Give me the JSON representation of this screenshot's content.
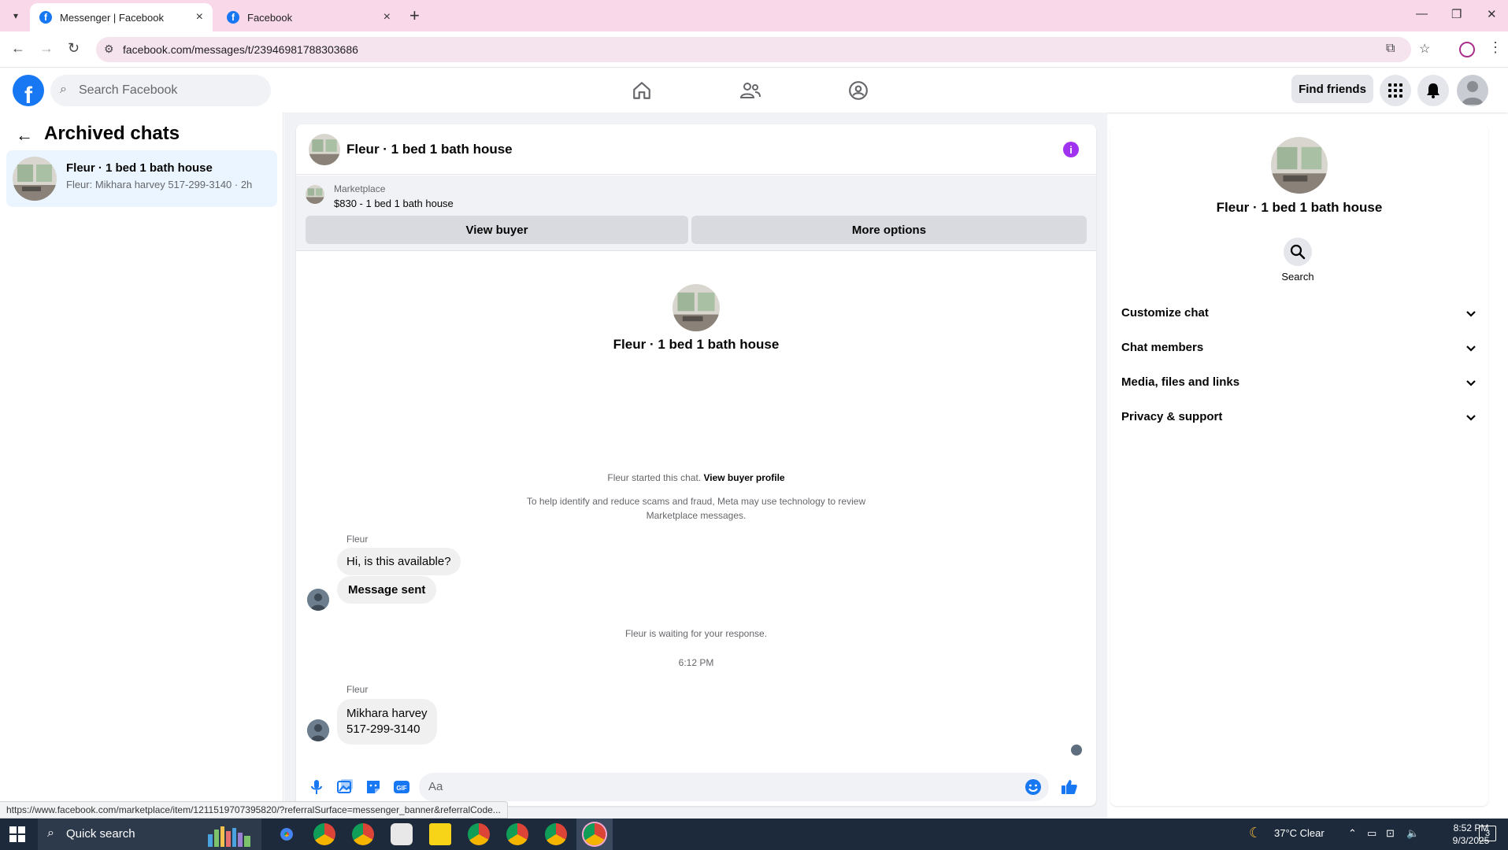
{
  "browser": {
    "tabs": [
      {
        "label": "Messenger | Facebook",
        "active": true
      },
      {
        "label": "Facebook",
        "active": false
      }
    ],
    "url": "facebook.com/messages/t/23946981788303686",
    "status_url": "https://www.facebook.com/marketplace/item/1211519707395820/?referralSurface=messenger_banner&referralCode..."
  },
  "header": {
    "search_placeholder": "Search Facebook",
    "find_friends": "Find friends",
    "logo_letter": "f"
  },
  "left": {
    "title": "Archived chats",
    "chats": [
      {
        "name": "Fleur · 1 bed 1 bath house",
        "preview": "Fleur: Mikhara harvey 517-299-3140 · 2h"
      }
    ]
  },
  "chat": {
    "title": "Fleur · 1 bed 1 bath house",
    "marketplace": {
      "label": "Marketplace",
      "listing": "$830 - 1 bed 1 bath house",
      "view_buyer": "View buyer",
      "more_options": "More options"
    },
    "intro_name": "Fleur · 1 bed 1 bath house",
    "started_text": "Fleur started this chat.",
    "started_link": "View buyer profile",
    "safety_note": "To help identify and reduce scams and fraud, Meta may use technology to review Marketplace messages.",
    "messages": [
      {
        "sender": "Fleur",
        "text1": "Hi, is this available?",
        "text2": "Message sent"
      },
      {
        "sender": "Fleur",
        "line1": "Mikhara harvey",
        "line2": "517-299-3140"
      }
    ],
    "waiting_text": "Fleur is waiting for your response.",
    "timestamp": "6:12 PM",
    "composer_placeholder": "Aa"
  },
  "right": {
    "title": "Fleur · 1 bed 1 bath house",
    "search_label": "Search",
    "sections": [
      "Customize chat",
      "Chat members",
      "Media, files and links",
      "Privacy & support"
    ]
  },
  "taskbar": {
    "search_label": "Quick search",
    "weather": "37°C  Clear",
    "time": "8:52 PM",
    "date": "9/3/2025",
    "notifications": "3"
  },
  "colors": {
    "brand": "#1877f2",
    "tabbar": "#f9d8ea",
    "info": "#a033f0"
  }
}
